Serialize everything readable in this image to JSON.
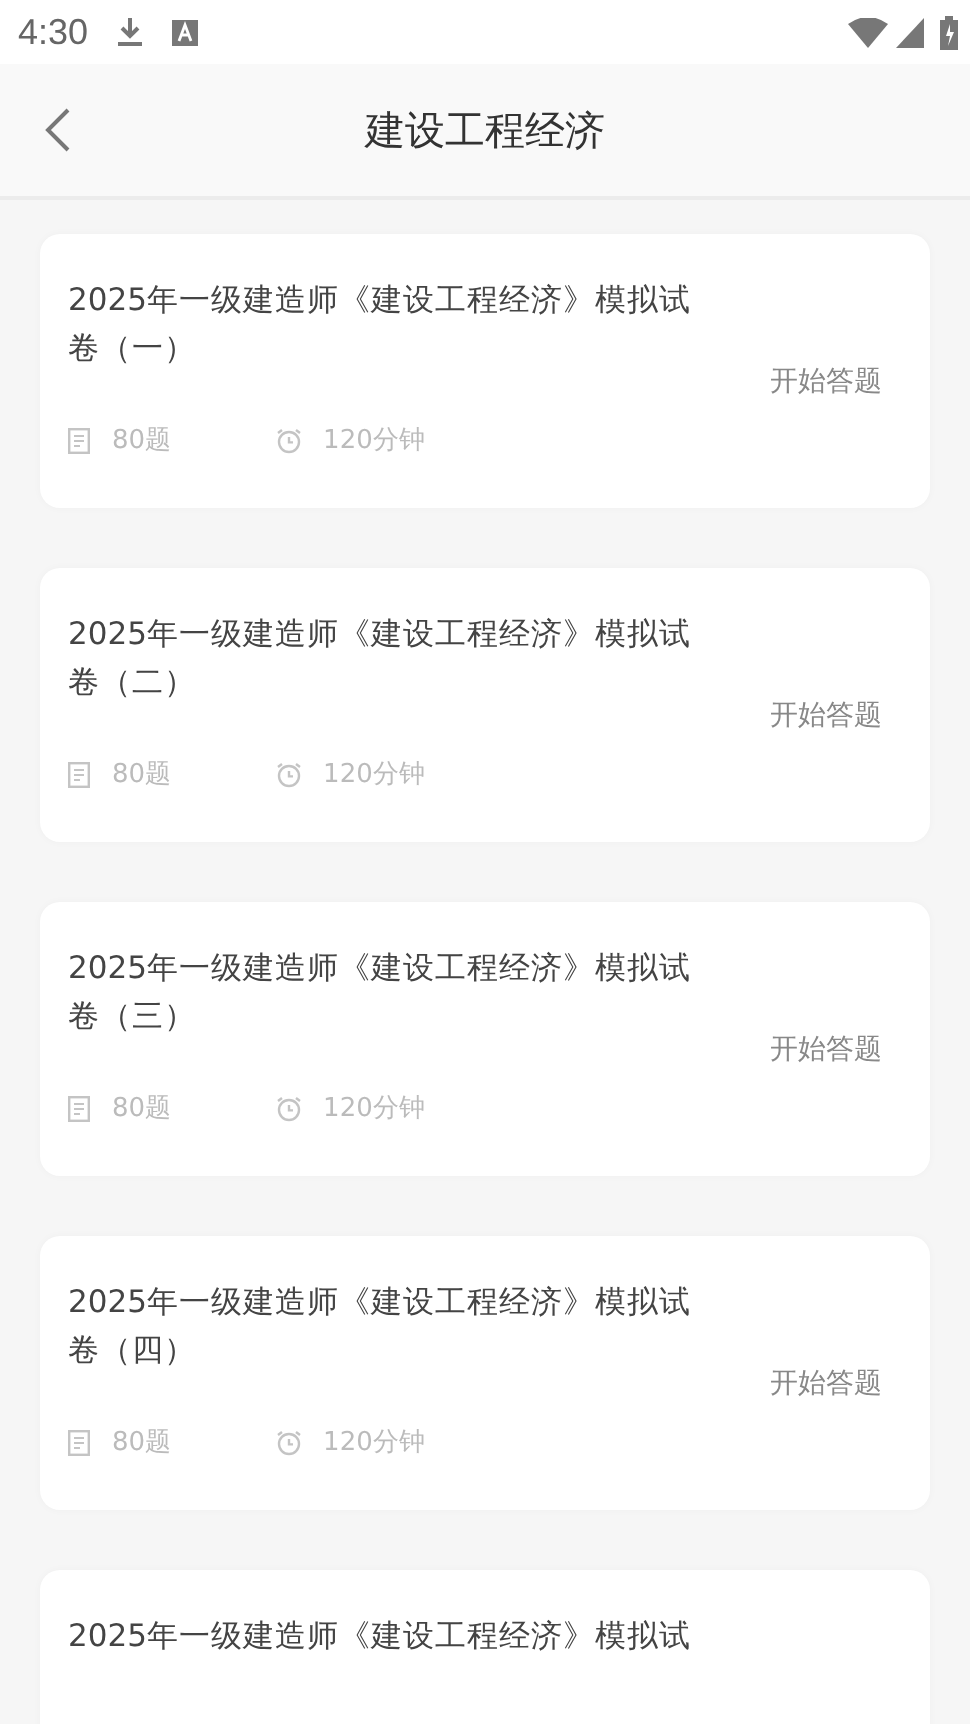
{
  "status_bar": {
    "time": "4:30"
  },
  "header": {
    "title": "建设工程经济"
  },
  "papers": [
    {
      "title": "2025年一级建造师《建设工程经济》模拟试卷（一）",
      "questions": "80题",
      "duration": "120分钟",
      "action": "开始答题"
    },
    {
      "title": "2025年一级建造师《建设工程经济》模拟试卷（二）",
      "questions": "80题",
      "duration": "120分钟",
      "action": "开始答题"
    },
    {
      "title": "2025年一级建造师《建设工程经济》模拟试卷（三）",
      "questions": "80题",
      "duration": "120分钟",
      "action": "开始答题"
    },
    {
      "title": "2025年一级建造师《建设工程经济》模拟试卷（四）",
      "questions": "80题",
      "duration": "120分钟",
      "action": "开始答题"
    },
    {
      "title": "2025年一级建造师《建设工程经济》模拟试"
    }
  ]
}
